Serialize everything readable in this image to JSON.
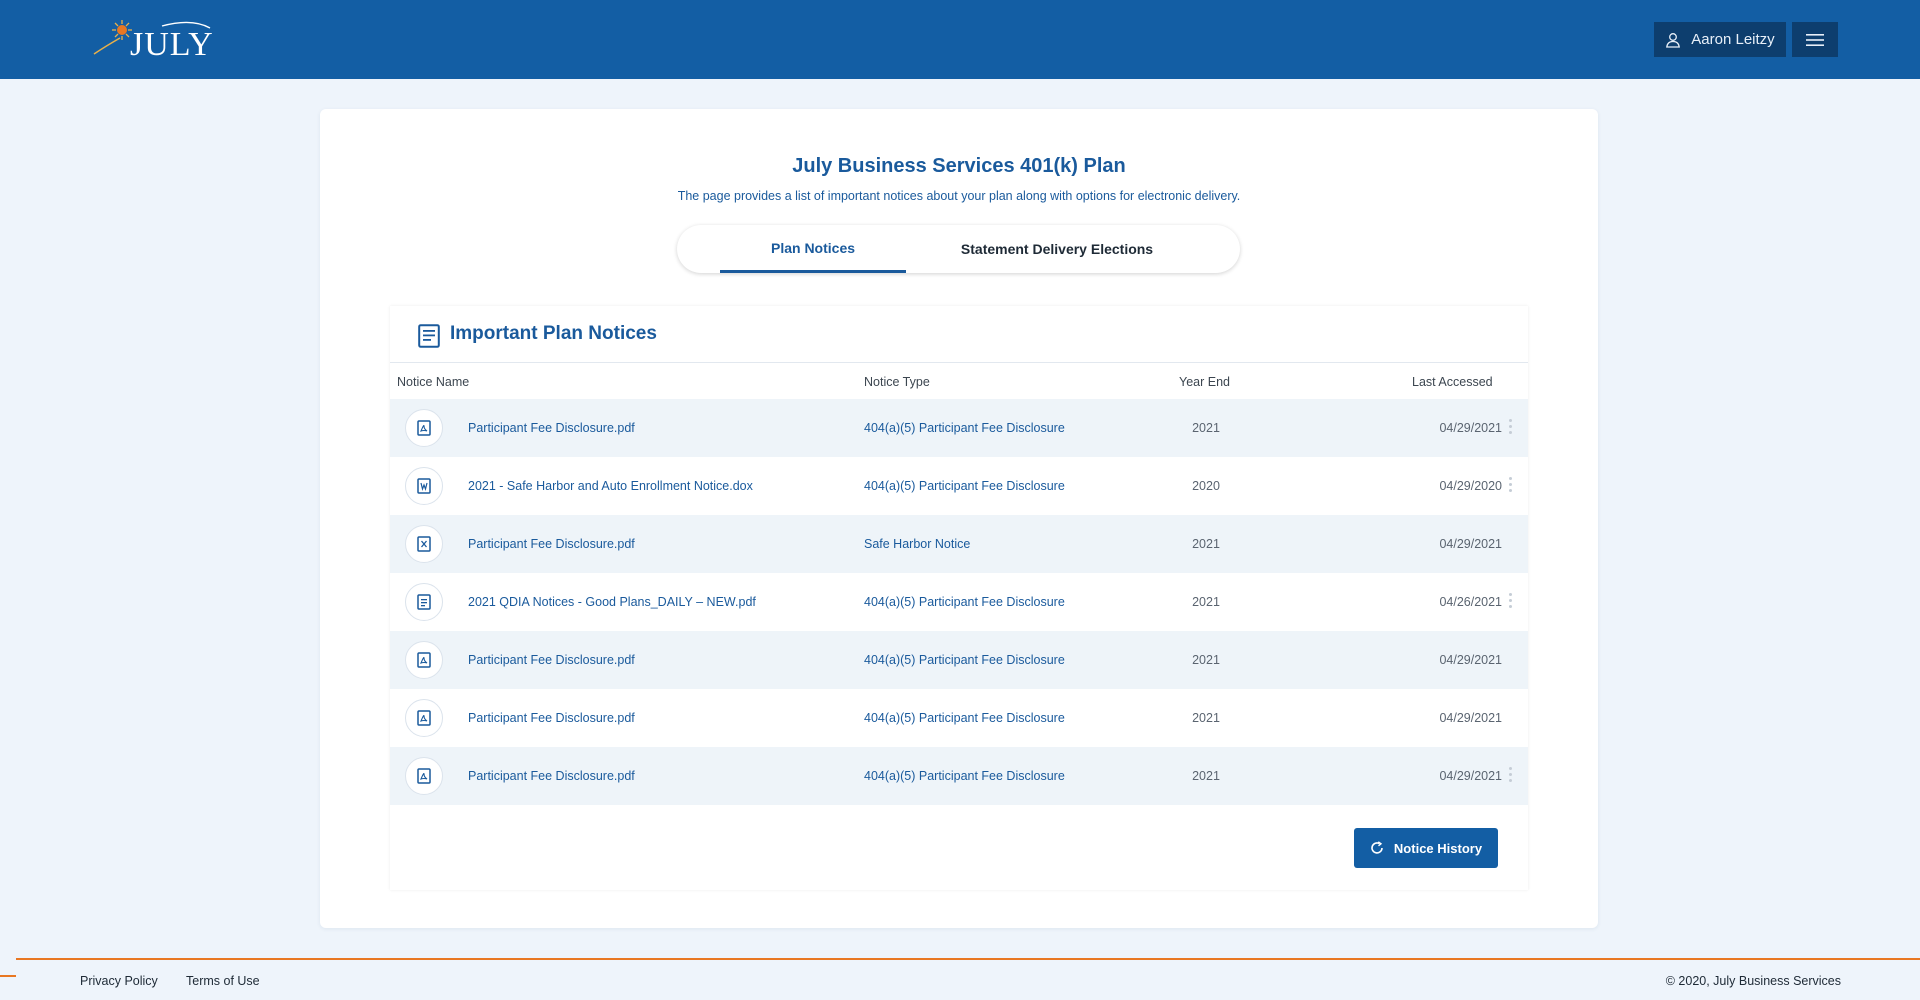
{
  "header": {
    "logo_text": "JULY",
    "user_name": "Aaron Leitzy",
    "brand_color": "#135ea4",
    "accent_color": "#e87722"
  },
  "plan": {
    "title": "July Business Services 401(k) Plan",
    "description": "The page provides a list of important notices about your plan along with options for electronic delivery."
  },
  "tabs": {
    "notices": "Plan Notices",
    "elections": "Statement Delivery Elections"
  },
  "notices": {
    "title": "Important Plan Notices",
    "columns": {
      "name": "Notice Name",
      "type": "Notice Type",
      "year": "Year End",
      "accessed": "Last Accessed"
    },
    "rows": [
      {
        "icon": "pdf-icon",
        "name": "Participant Fee Disclosure.pdf",
        "type": "404(a)(5) Participant Fee Disclosure",
        "year": "2021",
        "accessed": "04/29/2021",
        "menu": true
      },
      {
        "icon": "word-doc-icon",
        "name": "2021 - Safe Harbor and Auto Enrollment Notice.dox",
        "type": "404(a)(5) Participant Fee Disclosure",
        "year": "2020",
        "accessed": "04/29/2020",
        "menu": true
      },
      {
        "icon": "excel-doc-icon",
        "name": "Participant Fee Disclosure.pdf",
        "type": "Safe Harbor Notice",
        "year": "2021",
        "accessed": "04/29/2021",
        "menu": false
      },
      {
        "icon": "text-doc-icon",
        "name": "2021 QDIA Notices - Good Plans_DAILY – NEW.pdf",
        "type": "404(a)(5) Participant Fee Disclosure",
        "year": "2021",
        "accessed": "04/26/2021",
        "menu": true
      },
      {
        "icon": "pdf-icon",
        "name": "Participant Fee Disclosure.pdf",
        "type": "404(a)(5) Participant Fee Disclosure",
        "year": "2021",
        "accessed": "04/29/2021",
        "menu": false
      },
      {
        "icon": "pdf-icon",
        "name": "Participant Fee Disclosure.pdf",
        "type": "404(a)(5) Participant Fee Disclosure",
        "year": "2021",
        "accessed": "04/29/2021",
        "menu": false
      },
      {
        "icon": "pdf-icon",
        "name": "Participant Fee Disclosure.pdf",
        "type": "404(a)(5) Participant Fee Disclosure",
        "year": "2021",
        "accessed": "04/29/2021",
        "menu": true
      }
    ],
    "history_button": "Notice History"
  },
  "footer": {
    "privacy": "Privacy Policy",
    "terms": "Terms of Use",
    "copyright": "© 2020, July Business Services"
  }
}
